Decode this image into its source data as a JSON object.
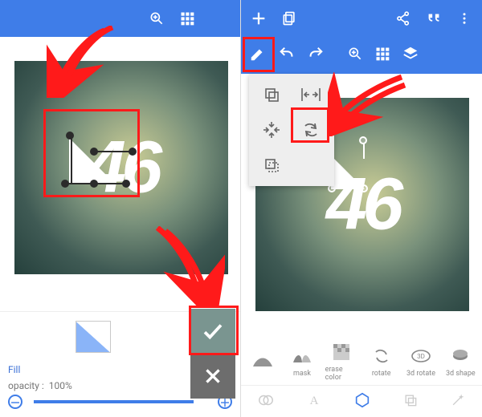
{
  "colors": {
    "toolbar": "#3F7DE8",
    "accent_red": "#ff1a1a",
    "check_bg": "#7a9590"
  },
  "left": {
    "toolbar": {
      "zoom": "zoom",
      "grid": "grid"
    },
    "canvas": {
      "text": "46"
    },
    "bottom": {
      "fill_label": "Fill",
      "opacity_label": "opacity :",
      "opacity_value": "100%",
      "check": "✓",
      "close": "✕"
    }
  },
  "right": {
    "toolbar": {
      "add": "+",
      "undo_stack": "copy",
      "share": "share",
      "quote": "quote",
      "more": "⋮",
      "edit": "edit",
      "undo": "undo",
      "redo": "redo",
      "zoom": "zoom",
      "grid": "grid",
      "layers": "layers"
    },
    "dropdown": {
      "items": [
        {
          "name": "duplicate"
        },
        {
          "name": "fit-width"
        },
        {
          "name": "center"
        },
        {
          "name": "rotate"
        },
        {
          "name": "crop"
        },
        {
          "name": "blank"
        }
      ]
    },
    "canvas": {
      "text": "46"
    },
    "tool_strip": [
      {
        "label": "",
        "icon": "slice"
      },
      {
        "label": "mask",
        "icon": "mask"
      },
      {
        "label": "erase color",
        "icon": "erase"
      },
      {
        "label": "rotate",
        "icon": "rotate"
      },
      {
        "label": "3d rotate",
        "icon": "3drotate"
      },
      {
        "label": "3d shape",
        "icon": "3dshape"
      }
    ],
    "categories": [
      "overlap",
      "text",
      "shape",
      "copy",
      "magic"
    ]
  }
}
